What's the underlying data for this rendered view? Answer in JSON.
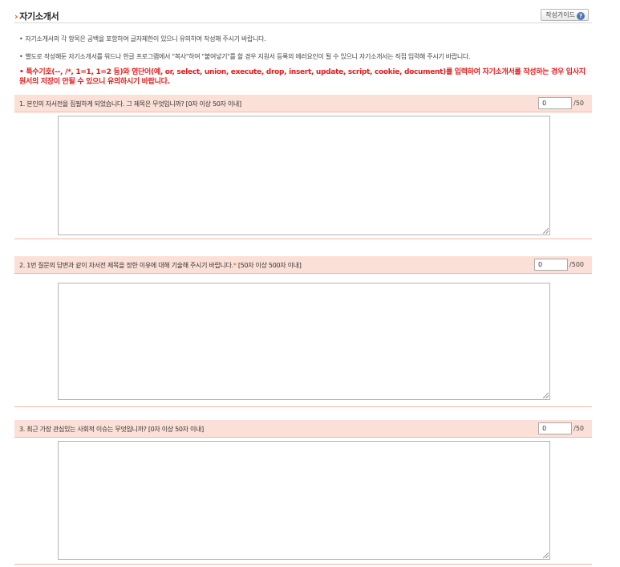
{
  "section": {
    "title": "자기소개서",
    "guide_button": "작성가이드",
    "guide_icon": "question-icon"
  },
  "notices": [
    "자기소개서의 각 항목은 공백을 포함하여 글자제한이 있으니 유의하여 작성해 주시기 바랍니다.",
    "별도로 작성해둔 자기소개서를 워드나 한글 프로그램에서 \"복사\"하여 \"붙여넣기\"를 할 경우 지원서 등록의 에러요인이 될 수 있으니 자기소개서는 직접 입력해 주시기 바랍니다.",
    "특수기호(--, /*, 1=1, 1=2 등)와 영단어(예, or, select, union, execute, drop, insert, update, script, cookie, document)를 입력하여 자기소개서를 작성하는 경우 입사지원서의 저장이 안될 수 있으니 유의하시기 바랍니다."
  ],
  "questions": [
    {
      "label": "1. 본인의 자서전을 집필하게 되었습니다. 그 제목은 무엇입니까? [0자 이상 50자 이내]",
      "star": "",
      "count": "0",
      "max": "/50",
      "answer": ""
    },
    {
      "label": "2. 1번 질문의 답변과 같이 자서전 제목을 정한 이유에 대해 기술해 주시기 바랍니다.",
      "star": "*",
      "limit": " [50자 이상 500자 이내]",
      "count": "0",
      "max": "/500",
      "answer": ""
    },
    {
      "label": "3. 최근 가장 관심있는 사회적 이슈는 무엇입니까? [0자 이상 50자 이내]",
      "star": "",
      "count": "0",
      "max": "/50",
      "answer": ""
    }
  ],
  "colors": {
    "accent": "#e8541c",
    "question_bar": "#fbe0d7",
    "warning": "#e21b1b"
  }
}
